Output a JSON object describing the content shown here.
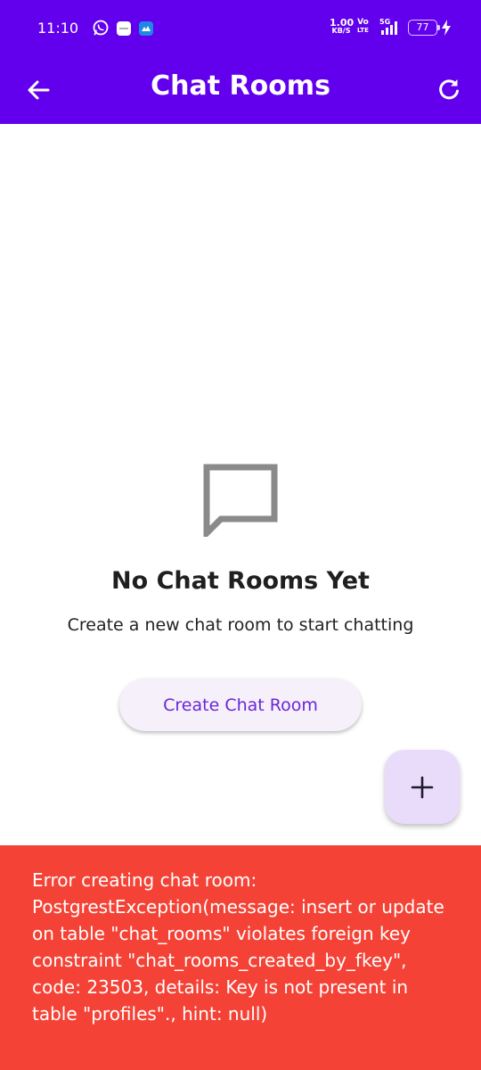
{
  "status_bar": {
    "time": "11:10",
    "net_speed_value": "1.00",
    "net_speed_unit": "KB/S",
    "volte_top": "Vo",
    "volte_bottom": "LTE",
    "network": "5G",
    "battery": "77"
  },
  "app_bar": {
    "title": "Chat Rooms",
    "back_icon": "arrow-back-icon",
    "refresh_icon": "refresh-icon"
  },
  "empty_state": {
    "icon": "chat-bubble-icon",
    "title": "No Chat Rooms Yet",
    "subtitle": "Create a new chat room to start chatting",
    "button_label": "Create Chat Room"
  },
  "fab": {
    "icon": "add-icon"
  },
  "snackbar": {
    "message": "Error creating chat room:\nPostgrestException(message: insert or update on table \"chat_rooms\" violates foreign key constraint \"chat_rooms_created_by_fkey\", code: 23503, details: Key is not present in table \"profiles\"., hint: null)"
  },
  "colors": {
    "primary": "#6200ee",
    "error": "#f44336",
    "button_text": "#6a27d6",
    "fab_background": "#e9dcfa"
  }
}
